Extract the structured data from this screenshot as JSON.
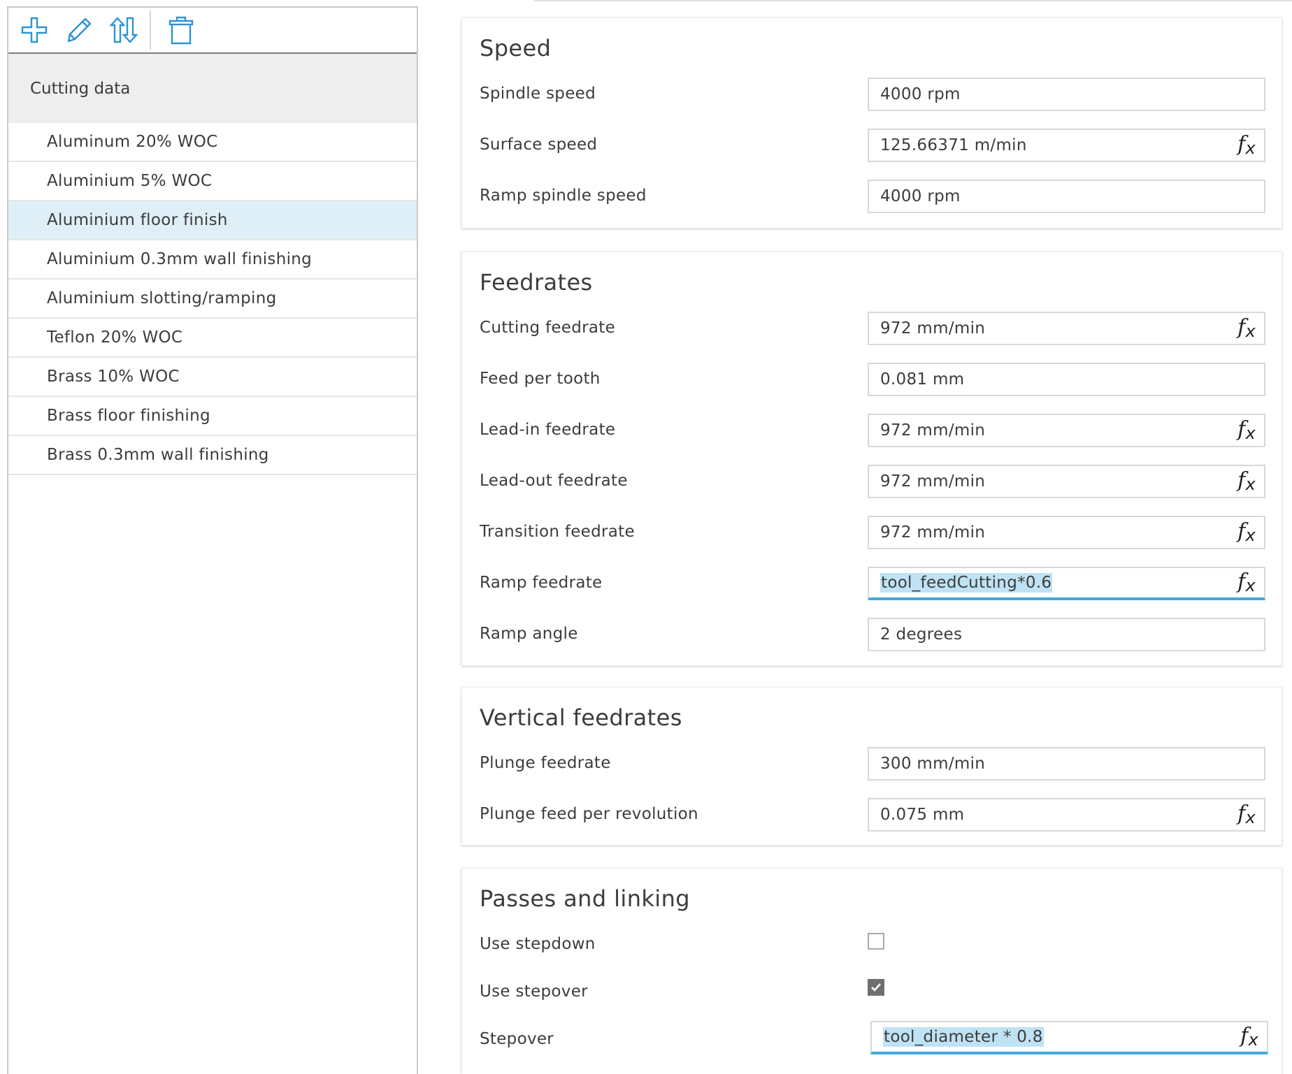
{
  "toolbar": {
    "icons": [
      "plus-icon",
      "pencil-icon",
      "sort-icon",
      "trash-icon"
    ],
    "accent_color": "#2a94d2"
  },
  "list": {
    "header": "Cutting data",
    "items": [
      "Aluminum 20% WOC",
      "Aluminium 5% WOC",
      "Aluminium floor finish",
      "Aluminium 0.3mm wall finishing",
      "Aluminium slotting/ramping",
      "Teflon 20% WOC",
      "Brass 10% WOC",
      "Brass floor finishing",
      "Brass 0.3mm wall finishing"
    ],
    "selected": "Aluminium floor finish",
    "selected_color": "#dfeff8"
  },
  "speed": {
    "title": "Speed",
    "spindle_speed": {
      "label": "Spindle speed",
      "value": "4000 rpm"
    },
    "surface_speed": {
      "label": "Surface speed",
      "value": "125.66371 m/min"
    },
    "ramp_spindle_speed": {
      "label": "Ramp spindle speed",
      "value": "4000 rpm"
    }
  },
  "feedrates": {
    "title": "Feedrates",
    "cutting_feedrate": {
      "label": "Cutting feedrate",
      "value": "972 mm/min"
    },
    "feed_per_tooth": {
      "label": "Feed per tooth",
      "value": "0.081 mm"
    },
    "lead_in_feedrate": {
      "label": "Lead-in feedrate",
      "value": "972 mm/min"
    },
    "lead_out_feedrate": {
      "label": "Lead-out feedrate",
      "value": "972 mm/min"
    },
    "transition_feedrate": {
      "label": "Transition feedrate",
      "value": "972 mm/min"
    },
    "ramp_feedrate": {
      "label": "Ramp feedrate",
      "value": "tool_feedCutting*0.6"
    },
    "ramp_angle": {
      "label": "Ramp angle",
      "value": "2 degrees"
    }
  },
  "vertical_feedrates": {
    "title": "Vertical feedrates",
    "plunge_feedrate": {
      "label": "Plunge feedrate",
      "value": "300 mm/min"
    },
    "plunge_feed_per_revolution": {
      "label": "Plunge feed per revolution",
      "value": "0.075 mm"
    }
  },
  "passes_and_linking": {
    "title": "Passes and linking",
    "use_stepdown": {
      "label": "Use stepdown",
      "checked": false
    },
    "use_stepover": {
      "label": "Use stepover",
      "checked": true
    },
    "stepover": {
      "label": "Stepover",
      "value": "tool_diameter * 0.8"
    }
  },
  "formula_button": {
    "f": "f",
    "x": "x"
  },
  "colors": {
    "active_underline": "#41a8dc",
    "selection_highlight": "#bfe2f4"
  }
}
